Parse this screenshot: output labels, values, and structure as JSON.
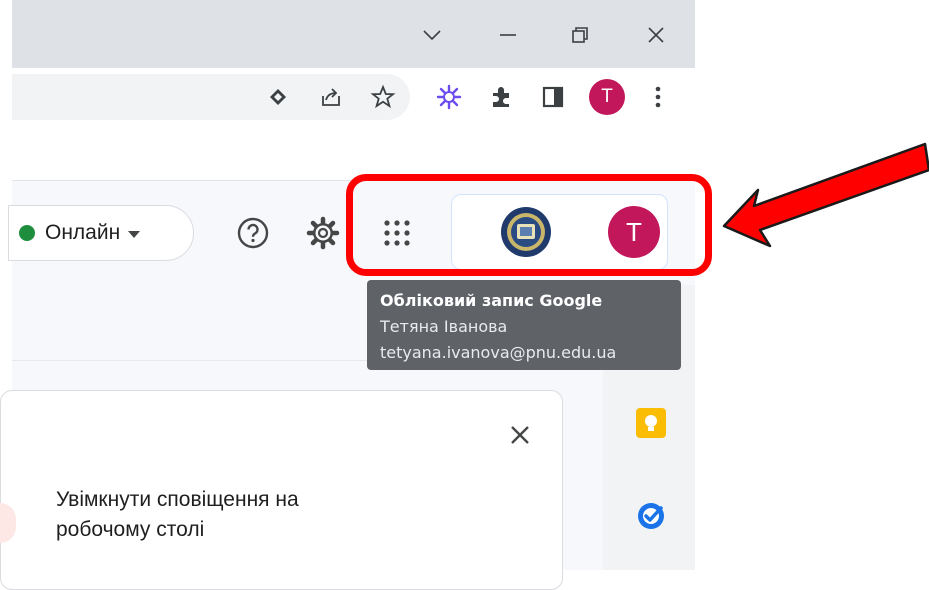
{
  "presence": {
    "label": "Онлайн"
  },
  "tooltip": {
    "title": "Обліковий запис Google",
    "name": "Тетяна Іванова",
    "email": "tetyana.ivanova@pnu.edu.ua"
  },
  "avatar": {
    "initial": "T"
  },
  "profile": {
    "initial": "T"
  },
  "notification": {
    "text": "Увімкнути сповіщення на робочому столі"
  },
  "colors": {
    "avatar": "#c2185b",
    "online": "#1e8e3e",
    "highlight": "#ff0000",
    "keep": "#fbbc04",
    "tasks": "#1a73e8"
  },
  "icons": {
    "window": [
      "chevron-down-icon",
      "minimize-icon",
      "restore-icon",
      "close-icon"
    ],
    "toolbar": [
      "lens-icon",
      "share-icon",
      "star-icon",
      "extension-burst-icon",
      "puzzle-icon",
      "side-panel-icon",
      "kebab-menu-icon"
    ],
    "gmail": [
      "help-icon",
      "gear-icon",
      "apps-grid-icon",
      "university-logo-icon"
    ],
    "side": [
      "calendar-icon",
      "keep-icon",
      "tasks-icon"
    ]
  }
}
